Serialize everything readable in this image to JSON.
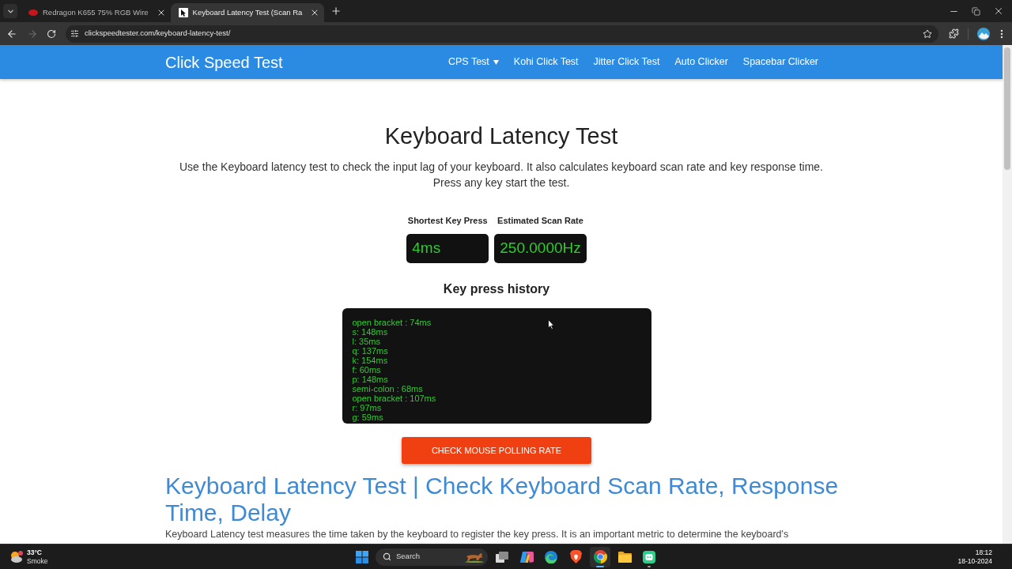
{
  "browser": {
    "tabs": [
      {
        "title": "Redragon K655 75% RGB Wire",
        "selected": false
      },
      {
        "title": "Keyboard Latency Test (Scan Ra",
        "selected": true
      }
    ],
    "forward_disabled": true,
    "url": "clickspeedtester.com/keyboard-latency-test/"
  },
  "site_header": {
    "brand": "Click Speed Test",
    "links": [
      {
        "label": "CPS Test",
        "dropdown": true
      },
      {
        "label": "Kohi Click Test",
        "dropdown": false
      },
      {
        "label": "Jitter Click Test",
        "dropdown": false
      },
      {
        "label": "Auto Clicker",
        "dropdown": false
      },
      {
        "label": "Spacebar Clicker",
        "dropdown": false
      }
    ]
  },
  "main": {
    "title": "Keyboard Latency Test",
    "description": "Use the Keyboard latency test to check the input lag of your keyboard. It also calculates keyboard scan rate and key response time. Press any key start the test.",
    "stats": [
      {
        "label": "Shortest Key Press",
        "value": "4ms"
      },
      {
        "label": "Estimated Scan Rate",
        "value": "250.0000Hz"
      }
    ],
    "history_title": "Key press history",
    "history": [
      "open bracket : 74ms",
      "s: 148ms",
      "l: 35ms",
      "q: 137ms",
      "k: 154ms",
      "f: 60ms",
      "p: 148ms",
      "semi-colon : 68ms",
      "open bracket : 107ms",
      "r: 97ms",
      "g: 59ms"
    ],
    "button": "CHECK MOUSE POLLING RATE",
    "article_heading": "Keyboard Latency Test | Check Keyboard Scan Rate, Response Time, Delay",
    "article_text": "Keyboard Latency test measures the time taken by the keyboard to register the key press. It is an important metric to determine the keyboard's"
  },
  "taskbar": {
    "weather": {
      "temperature": "33°C",
      "condition": "Smoke"
    },
    "search": {
      "label": "Search"
    },
    "apps": [
      {
        "kind": "task-view",
        "running": false,
        "focused": false
      },
      {
        "kind": "swirl",
        "running": false,
        "focused": false
      },
      {
        "kind": "wave-browser",
        "running": false,
        "focused": false
      },
      {
        "kind": "shield-browser",
        "running": false,
        "focused": false
      },
      {
        "kind": "circle-browser",
        "running": true,
        "focused": true
      },
      {
        "kind": "folder",
        "running": false,
        "focused": false
      },
      {
        "kind": "green-app",
        "running": true,
        "focused": false
      }
    ],
    "time": "18:12",
    "date": "18-10-2024"
  }
}
